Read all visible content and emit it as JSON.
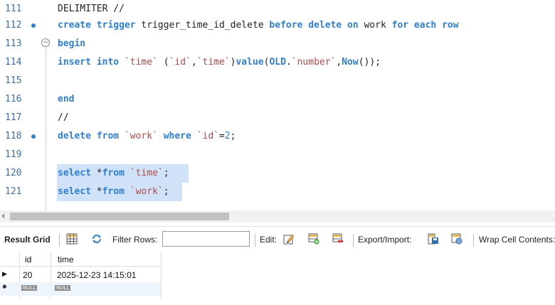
{
  "editor": {
    "lines": [
      {
        "num": "111",
        "dot": false,
        "fold": false,
        "tokens": [
          {
            "t": "id",
            "v": "DELIMITER //"
          }
        ]
      },
      {
        "num": "112",
        "dot": true,
        "fold": false,
        "tokens": [
          {
            "t": "kw",
            "v": "create trigger "
          },
          {
            "t": "id",
            "v": "trigger_time_id_delete "
          },
          {
            "t": "kw",
            "v": "before delete on "
          },
          {
            "t": "id",
            "v": "work "
          },
          {
            "t": "kw",
            "v": "for each row"
          }
        ]
      },
      {
        "num": "113",
        "dot": false,
        "fold": true,
        "tokens": [
          {
            "t": "kw",
            "v": "begin"
          }
        ]
      },
      {
        "num": "114",
        "dot": false,
        "fold": false,
        "tokens": [
          {
            "t": "kw",
            "v": "insert into "
          },
          {
            "t": "str",
            "v": "`time`"
          },
          {
            "t": "id",
            "v": " ("
          },
          {
            "t": "str",
            "v": "`id`"
          },
          {
            "t": "id",
            "v": ","
          },
          {
            "t": "str",
            "v": "`time`"
          },
          {
            "t": "id",
            "v": ")"
          },
          {
            "t": "kw",
            "v": "value"
          },
          {
            "t": "id",
            "v": "("
          },
          {
            "t": "kw",
            "v": "OLD"
          },
          {
            "t": "id",
            "v": "."
          },
          {
            "t": "str",
            "v": "`number`"
          },
          {
            "t": "id",
            "v": ","
          },
          {
            "t": "kw",
            "v": "Now"
          },
          {
            "t": "id",
            "v": "());"
          }
        ]
      },
      {
        "num": "115",
        "dot": false,
        "fold": false,
        "tokens": []
      },
      {
        "num": "116",
        "dot": false,
        "fold": false,
        "tokens": [
          {
            "t": "kw",
            "v": "end"
          }
        ]
      },
      {
        "num": "117",
        "dot": false,
        "fold": false,
        "tokens": [
          {
            "t": "id",
            "v": "//"
          }
        ]
      },
      {
        "num": "118",
        "dot": true,
        "fold": false,
        "tokens": [
          {
            "t": "kw",
            "v": "delete from "
          },
          {
            "t": "str",
            "v": "`work`"
          },
          {
            "t": "kw",
            "v": " where "
          },
          {
            "t": "str",
            "v": "`id`"
          },
          {
            "t": "id",
            "v": "="
          },
          {
            "t": "num",
            "v": "2"
          },
          {
            "t": "id",
            "v": ";"
          }
        ]
      },
      {
        "num": "119",
        "dot": false,
        "fold": false,
        "tokens": []
      },
      {
        "num": "120",
        "dot": false,
        "fold": false,
        "selected": true,
        "tokens": [
          {
            "t": "kw",
            "v": "select "
          },
          {
            "t": "id",
            "v": "*"
          },
          {
            "t": "kw",
            "v": "from "
          },
          {
            "t": "str",
            "v": "`time`"
          },
          {
            "t": "id",
            "v": ";"
          }
        ]
      },
      {
        "num": "121",
        "dot": false,
        "fold": false,
        "selected": true,
        "tokens": [
          {
            "t": "kw",
            "v": "select "
          },
          {
            "t": "id",
            "v": "*"
          },
          {
            "t": "kw",
            "v": "from "
          },
          {
            "t": "str",
            "v": "`work`"
          },
          {
            "t": "id",
            "v": ";"
          }
        ]
      }
    ],
    "fold_glyph": "−"
  },
  "scroll": {
    "left_arrow": "‹"
  },
  "toolbar": {
    "result_grid": "Result Grid",
    "filter_rows": "Filter Rows:",
    "filter_value": "",
    "edit": "Edit:",
    "export_import": "Export/Import:",
    "wrap": "Wrap Cell Contents:"
  },
  "grid": {
    "columns": [
      "id",
      "time"
    ],
    "rows": [
      {
        "marker": "▶",
        "id": "20",
        "time": "2025-12-23 14:15:01"
      },
      {
        "marker": "✱",
        "id": "NULL",
        "time": "NULL"
      }
    ]
  },
  "colors": {
    "keyword": "#2f7fd1",
    "string": "#b24a4a",
    "selection": "#cfe2f7"
  }
}
